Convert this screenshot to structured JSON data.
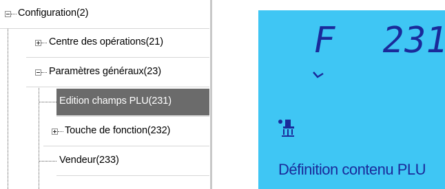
{
  "tree": {
    "items": [
      {
        "label": "Configuration(2)",
        "expander": "minus",
        "selected": false
      },
      {
        "label": "Centre des opérations(21)",
        "expander": "plus",
        "selected": false
      },
      {
        "label": "Paramètres généraux(23)",
        "expander": "minus",
        "selected": false
      },
      {
        "label": "Edition champs PLU(231)",
        "expander": "none",
        "selected": true
      },
      {
        "label": "Touche de fonction(232)",
        "expander": "plus",
        "selected": false
      },
      {
        "label": "Vendeur(233)",
        "expander": "none",
        "selected": false
      }
    ],
    "selected_color": "#6b6b6b"
  },
  "lcd": {
    "mode_letter": "F",
    "code": "231",
    "message": "Définition contenu PLU",
    "background_color": "#3fc6f4",
    "segment_color": "#1a2a9a",
    "indicators": [
      "arrow-indicator-icon",
      "hand-register-icon"
    ]
  }
}
